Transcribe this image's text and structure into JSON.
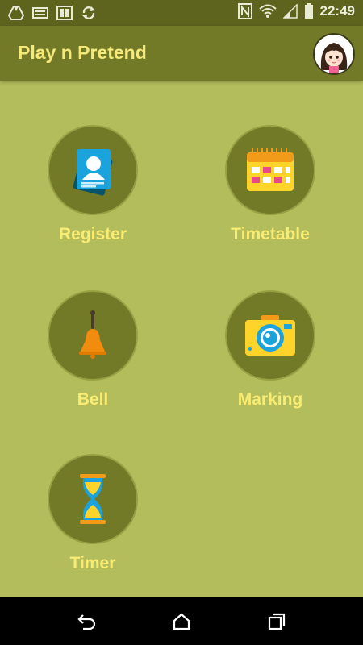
{
  "status_bar": {
    "time": "22:49",
    "left_icons": [
      "drive-icon",
      "keyboard-icon",
      "book-icon",
      "sync-icon"
    ],
    "right_icons": [
      "nfc-icon",
      "wifi-icon",
      "signal-icon",
      "battery-icon"
    ]
  },
  "app_bar": {
    "title": "Play n Pretend",
    "avatar_icon": "girl-avatar-icon"
  },
  "tiles": [
    {
      "label": "Register",
      "icon": "register-card-icon"
    },
    {
      "label": "Timetable",
      "icon": "calendar-icon"
    },
    {
      "label": "Bell",
      "icon": "bell-icon"
    },
    {
      "label": "Marking",
      "icon": "camera-icon"
    },
    {
      "label": "Timer",
      "icon": "hourglass-icon"
    }
  ],
  "nav_bar": {
    "buttons": [
      "back-icon",
      "home-icon",
      "recents-icon"
    ]
  },
  "colors": {
    "background": "#b3bd5b",
    "app_bar": "#737a27",
    "status_bar": "#5e631e",
    "accent_text": "#f8ec74"
  }
}
